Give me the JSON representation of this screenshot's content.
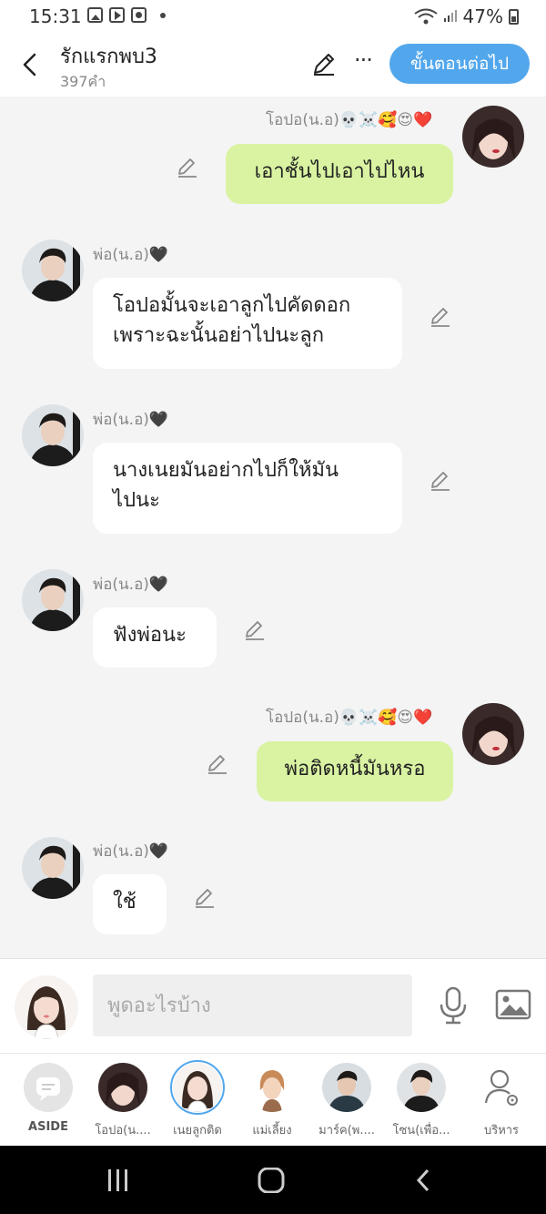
{
  "status": {
    "time": "15:31",
    "battery": "47%"
  },
  "header": {
    "title": "รักแรกพบ3",
    "word_count": "397คำ",
    "next_label": "ขั้นตอนต่อไป"
  },
  "messages": [
    {
      "side": "right",
      "name": "โอปอ(น.อ)",
      "name_emoji": "💀☠️🥰😍❤️",
      "text": "เอาชั้นไปเอาไปไหน"
    },
    {
      "side": "left",
      "name": "พ่อ(น.อ)",
      "name_emoji": "🖤",
      "lines": [
        "โอปอมั้นจะเอาลูกไปคัดดอก",
        "เพราะฉะนั้นอย่าไปนะลูก"
      ]
    },
    {
      "side": "left",
      "name": "พ่อ(น.อ)",
      "name_emoji": "🖤",
      "lines": [
        "นางเนยมันอย่ากไปก็ให้มัน",
        "ไปนะ"
      ]
    },
    {
      "side": "left",
      "name": "พ่อ(น.อ)",
      "name_emoji": "🖤",
      "text": "ฟังพ่อนะ"
    },
    {
      "side": "right",
      "name": "โอปอ(น.อ)",
      "name_emoji": "💀☠️🥰😍❤️",
      "text": "พ่อติดหนี้มันหรอ"
    },
    {
      "side": "left",
      "name": "พ่อ(น.อ)",
      "name_emoji": "🖤",
      "text": "ใช้"
    }
  ],
  "input": {
    "placeholder": "พูดอะไรบ้าง"
  },
  "characters": [
    {
      "label": "ASIDE"
    },
    {
      "label": "โอปอ(น...."
    },
    {
      "label": "เนยลูกติด"
    },
    {
      "label": "แม่เลี้ยง"
    },
    {
      "label": "มาร์ค(พ...."
    },
    {
      "label": "โซน(เพื่อ..."
    },
    {
      "label": "บริหาร"
    }
  ],
  "colors": {
    "accent": "#52a7ec",
    "right_bubble": "#d9f3a2"
  }
}
